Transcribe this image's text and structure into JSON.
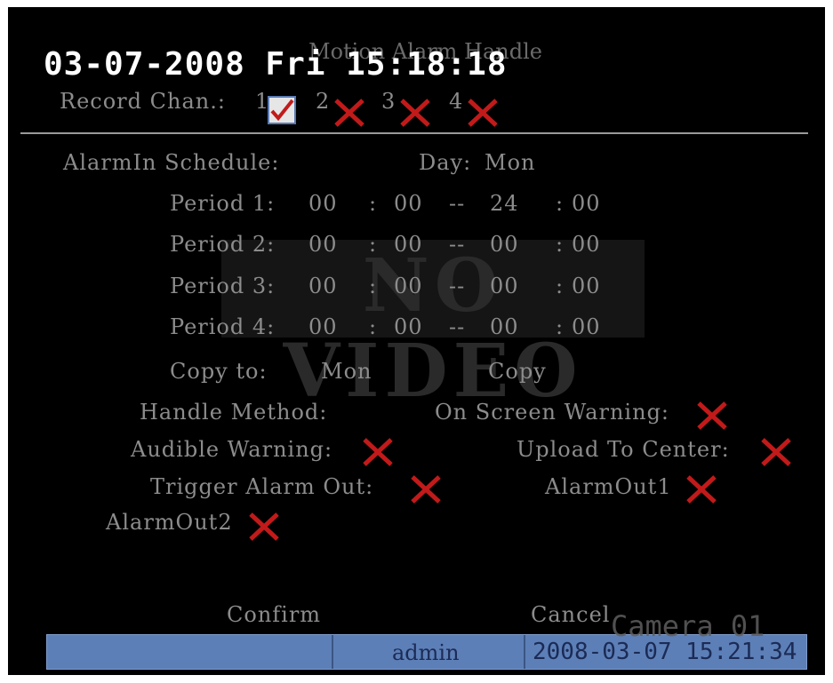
{
  "osd": {
    "datetime": "03-07-2008 Fri 15:18:18",
    "camera": "Camera 01",
    "no_video": "NO VIDEO"
  },
  "header": {
    "title": "Motion Alarm Handle",
    "record_chan_label": "Record Chan.:",
    "channels": [
      {
        "label": "1",
        "checked": true
      },
      {
        "label": "2",
        "checked": false
      },
      {
        "label": "3",
        "checked": false
      },
      {
        "label": "4",
        "checked": false
      }
    ]
  },
  "schedule": {
    "label": "AlarmIn Schedule:",
    "day_label": "Day:",
    "day_value": "Mon",
    "periods": [
      {
        "label": "Period 1:",
        "start_h": "00",
        "start_m": "00",
        "end_h": "24",
        "end_m": "00"
      },
      {
        "label": "Period 2:",
        "start_h": "00",
        "start_m": "00",
        "end_h": "00",
        "end_m": "00"
      },
      {
        "label": "Period 3:",
        "start_h": "00",
        "start_m": "00",
        "end_h": "00",
        "end_m": "00"
      },
      {
        "label": "Period 4:",
        "start_h": "00",
        "start_m": "00",
        "end_h": "00",
        "end_m": "00"
      }
    ],
    "colon": ":",
    "dash": "--",
    "copy_to_label": "Copy to:",
    "copy_to_value": "Mon",
    "copy_button": "Copy"
  },
  "handle": {
    "method_label": "Handle Method:",
    "on_screen_warning": "On Screen Warning:",
    "audible_warning": "Audible Warning:",
    "upload_to_center": "Upload To Center:",
    "trigger_alarm_out": "Trigger Alarm Out:",
    "alarm_out1": "AlarmOut1",
    "alarm_out2": "AlarmOut2"
  },
  "buttons": {
    "confirm": "Confirm",
    "cancel": "Cancel"
  },
  "status": {
    "user": "admin",
    "time": "2008-03-07 15:21:34"
  },
  "colors": {
    "background": "#000000",
    "text": "#8c8c8c",
    "unchecked_mark": "#c21a1a",
    "status_bar": "#5d7fb7"
  }
}
